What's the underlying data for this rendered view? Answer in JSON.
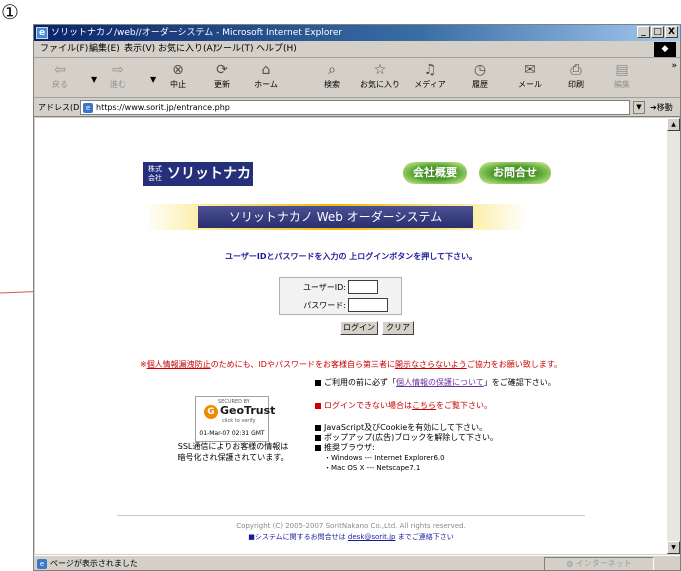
{
  "marker": "①",
  "window": {
    "title": "ソリットナカノ/web//オーダーシステム - Microsoft Internet Explorer",
    "controls": [
      "_",
      "□",
      "X"
    ]
  },
  "menu": {
    "items": [
      "ファイル(F)",
      "編集(E)",
      "表示(V)",
      "お気に入り(A)",
      "ツール(T)",
      "ヘルプ(H)"
    ]
  },
  "toolbar": {
    "back": "戻る",
    "forward": "進む",
    "stop": "中止",
    "refresh": "更新",
    "home": "ホーム",
    "search": "検索",
    "favorites": "お気に入り",
    "media": "メディア",
    "history": "履歴",
    "mail": "メール",
    "print": "印刷",
    "edit": "編集",
    "more": "»"
  },
  "address": {
    "label": "アドレス(D)",
    "url": "https://www.sorit.jp/entrance.php",
    "go_label": "移動"
  },
  "page": {
    "logo_small": "株式会社",
    "logo_main": "ソリットナカノ",
    "company_button": "会社概要",
    "contact_button": "お問合せ",
    "banner_title": "ソリットナカノ Web オーダーシステム",
    "instruction": "ユーザーIDとパスワードを入力の 上ログインボタンを押して下さい。",
    "userid_label": "ユーザーID:",
    "password_label": "パスワード:",
    "login_button": "ログイン",
    "clear_button": "クリア",
    "notice_prefix": "※",
    "notice_link1": "個人情報漏洩防止",
    "notice_mid": "のためにも、IDやパスワードをお客様自ら第三者に",
    "notice_link2": "開示なさらないよう",
    "notice_suffix": "ご協力をお願い致します。",
    "geotrust_top": "SECURED BY",
    "geotrust_name": "GeoTrust",
    "geotrust_click": "click to verify",
    "geotrust_date": "01-Mar-07 02:31 GMT",
    "ssl_line1": "SSL通信によりお客様の情報は",
    "ssl_line2": "暗号化され保護されています。",
    "item1_prefix": "ご利用の前に必ず「",
    "item1_link": "個人情報の保護について",
    "item1_suffix": "」をご確認下さい。",
    "item2_prefix": "ログインできない場合は",
    "item2_link": "こちら",
    "item2_suffix": "をご覧下さい。",
    "item3_line1": "JavaScript及びCookieを有効にして下さい。",
    "item3_line2": "ポップアップ(広告)ブロックを解除して下さい。",
    "item3_line3": "推奨ブラウザ:",
    "item3_line4": "・Windows --- Internet Explorer6.0",
    "item3_line5": "・Mac OS X --- Netscape7.1",
    "copyright": "Copyright (C) 2005-2007 SoritNakano Co.,Ltd. All rights reserved.",
    "contact_prefix": "■システムに関するお問合せは ",
    "contact_email": "desk@sorit.jp",
    "contact_suffix": " までご連絡下さい"
  },
  "status": {
    "text": "ページが表示されました",
    "zone_text": "インターネット"
  },
  "colors": {
    "accent": "#26307a",
    "notice": "#cc0000",
    "link": "#1a1a99"
  }
}
